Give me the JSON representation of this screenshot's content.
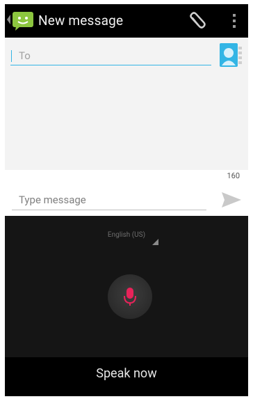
{
  "action_bar": {
    "title": "New message",
    "icons": {
      "back": "back-caret-icon",
      "app": "messaging-app-icon",
      "attach": "paperclip-icon",
      "overflow": "overflow-menu-icon"
    }
  },
  "compose": {
    "to_placeholder": "To",
    "contact_icon": "contact-picker-icon",
    "char_counter": "160",
    "message_placeholder": "Type message",
    "send_icon": "send-icon"
  },
  "voice_input": {
    "language": "English (US)",
    "mic_icon": "microphone-icon",
    "prompt": "Speak now"
  },
  "colors": {
    "accent": "#33b5e5",
    "mic": "#e8235a",
    "app_icon": "#8cc63f",
    "background": "#000000"
  }
}
